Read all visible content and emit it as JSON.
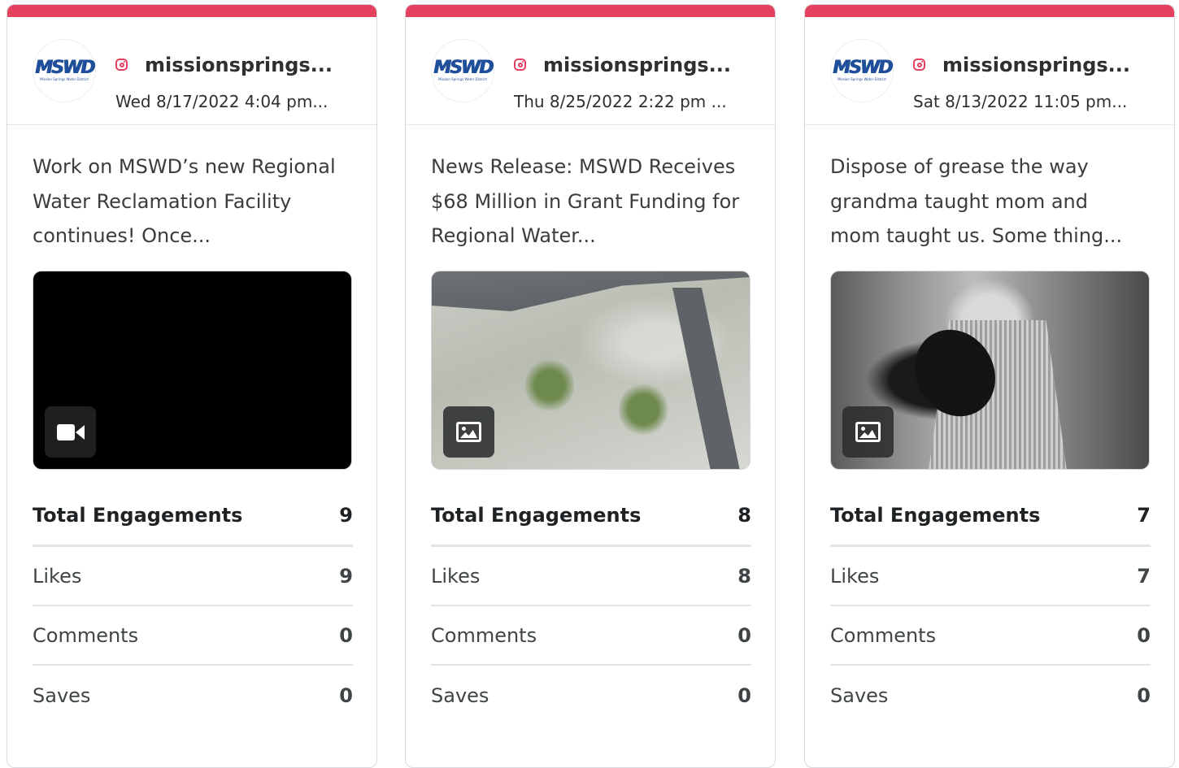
{
  "colors": {
    "instagram_accent": "#e4405f",
    "text_dark": "#2d2f31"
  },
  "avatar": {
    "logo_text": "MSWD",
    "logo_subtitle": "Mission Springs Water District"
  },
  "labels": {
    "total_engagements": "Total Engagements",
    "likes": "Likes",
    "comments": "Comments",
    "saves": "Saves"
  },
  "posts": [
    {
      "handle": "missionsprings...",
      "date": "Wed 8/17/2022 4:04 pm...",
      "text": "Work on MSWD’s new Regional Water Reclamation Facility continues! Once...",
      "media_type": "video",
      "media_icon": "video-camera-icon",
      "total_engagements": "9",
      "likes": "9",
      "comments": "0",
      "saves": "0"
    },
    {
      "handle": "missionsprings...",
      "date": "Thu 8/25/2022 2:22 pm ...",
      "text": "News Release: MSWD Receives $68 Million in Grant Funding for Regional Water...",
      "media_type": "image",
      "media_icon": "image-icon",
      "total_engagements": "8",
      "likes": "8",
      "comments": "0",
      "saves": "0"
    },
    {
      "handle": "missionsprings...",
      "date": "Sat 8/13/2022 11:05 pm...",
      "text": "Dispose of grease the way grandma taught mom and mom taught us. Some thing...",
      "media_type": "image",
      "media_icon": "image-icon",
      "total_engagements": "7",
      "likes": "7",
      "comments": "0",
      "saves": "0"
    }
  ]
}
